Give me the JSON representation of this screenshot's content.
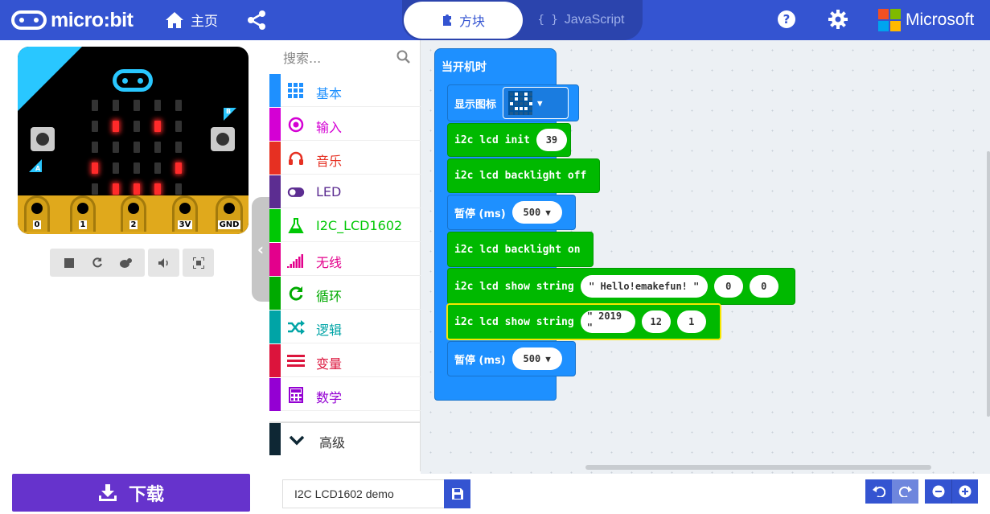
{
  "header": {
    "brand": "micro:bit",
    "home_label": "主页",
    "modes": {
      "blocks": "方块",
      "javascript": "JavaScript",
      "js_braces": "{ }"
    },
    "vendor": "Microsoft"
  },
  "colors": {
    "topbar": "#3454d1",
    "download": "#6633cc",
    "ms_red": "#f25022",
    "ms_green": "#7fba00",
    "ms_blue": "#00a4ef",
    "ms_yellow": "#ffb900"
  },
  "simulator": {
    "pins": [
      "0",
      "1",
      "2",
      "3V",
      "GND"
    ],
    "button_a": "A",
    "button_b": "B",
    "controls": [
      "stop-icon",
      "restart-icon",
      "debug-icon",
      "sound-icon",
      "fullscreen-icon"
    ]
  },
  "download": {
    "label": "下载"
  },
  "toolbox": {
    "search_placeholder": "搜索...",
    "categories": [
      {
        "label": "基本",
        "color": "#1e90ff",
        "icon": "grid-icon"
      },
      {
        "label": "输入",
        "color": "#d400d4",
        "icon": "target-icon"
      },
      {
        "label": "音乐",
        "color": "#e63022",
        "icon": "headphones-icon"
      },
      {
        "label": "LED",
        "color": "#5c2d91",
        "icon": "toggle-icon"
      },
      {
        "label": "I2C_LCD1602",
        "color": "#00c805",
        "icon": "flask-icon"
      },
      {
        "label": "无线",
        "color": "#e3008c",
        "icon": "signal-icon"
      },
      {
        "label": "循环",
        "color": "#00aa00",
        "icon": "loop-icon"
      },
      {
        "label": "逻辑",
        "color": "#00a4a6",
        "icon": "shuffle-icon"
      },
      {
        "label": "变量",
        "color": "#dc143c",
        "icon": "lines-icon"
      },
      {
        "label": "数学",
        "color": "#9400d3",
        "icon": "calculator-icon"
      }
    ],
    "advanced": "高级"
  },
  "workspace": {
    "event_label": "当开机时",
    "blocks": {
      "show_icon": "显示图标",
      "lcd_init": "i2c lcd init",
      "lcd_init_addr": "39",
      "backlight_off": "i2c lcd backlight off",
      "pause1_label": "暂停 (ms)",
      "pause1_value": "500",
      "backlight_on": "i2c lcd backlight on",
      "show_string1": "i2c lcd show string",
      "show_string1_text": "\" Hello!emakefun! \"",
      "show_string1_x": "0",
      "show_string1_y": "0",
      "show_string2": "i2c lcd show string",
      "show_string2_text": "\" 2019 \"",
      "show_string2_x": "12",
      "show_string2_y": "1",
      "pause2_label": "暂停 (ms)",
      "pause2_value": "500"
    }
  },
  "bottombar": {
    "project_name": "I2C LCD1602 demo"
  }
}
